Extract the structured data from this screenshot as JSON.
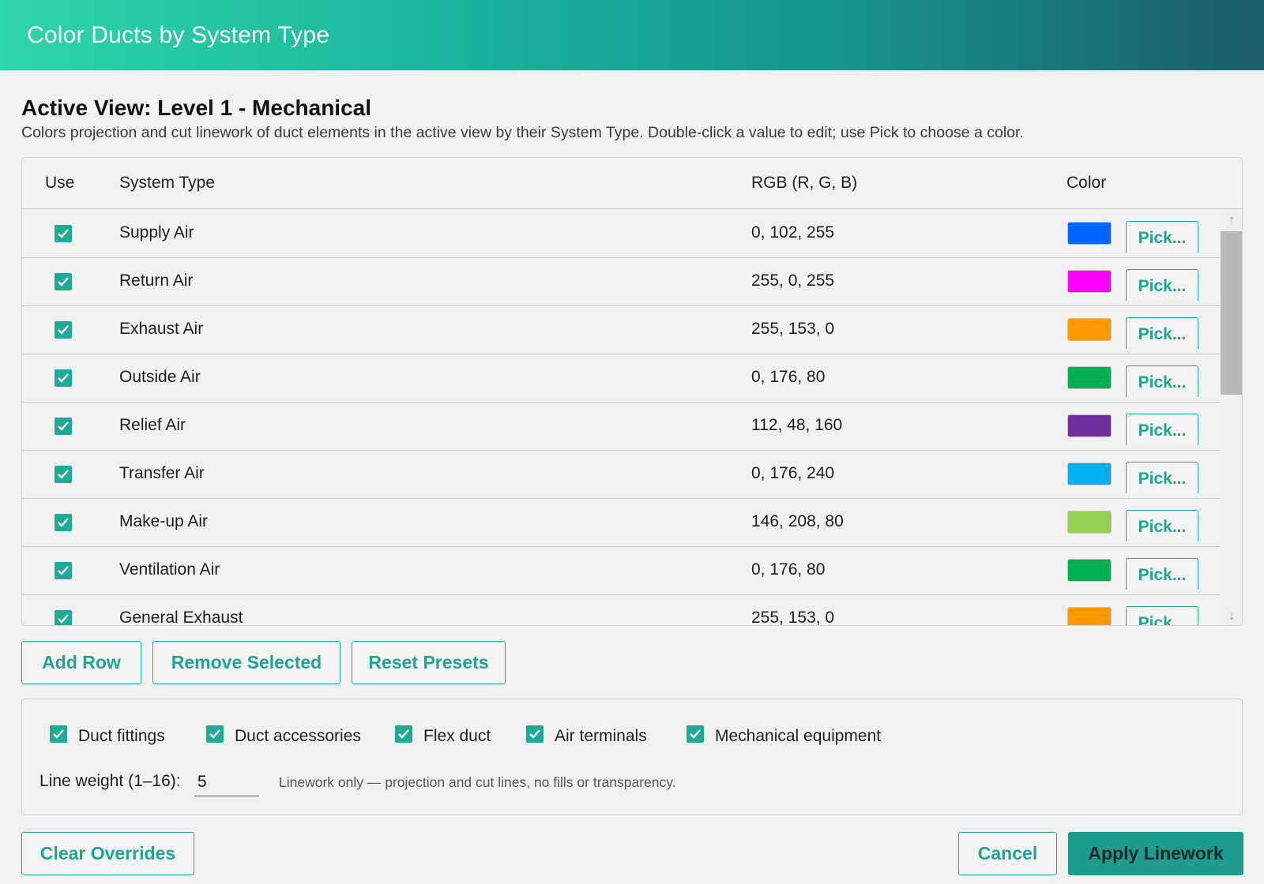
{
  "window": {
    "title": "Color Ducts by System Type"
  },
  "view": {
    "heading": "Active View: Level 1 - Mechanical",
    "description": "Colors projection and cut linework of duct elements in the active view by their System Type. Double-click a value to edit; use Pick to choose a color."
  },
  "table": {
    "columns": {
      "use": "Use",
      "system_type": "System Type",
      "rgb": "RGB (R, G, B)",
      "color": "Color"
    },
    "pick_label": "Pick...",
    "rows": [
      {
        "checked": true,
        "system_type": "Supply Air",
        "rgb": "0, 102, 255",
        "color": "#0066ff"
      },
      {
        "checked": true,
        "system_type": "Return Air",
        "rgb": "255, 0, 255",
        "color": "#ff00ff"
      },
      {
        "checked": true,
        "system_type": "Exhaust Air",
        "rgb": "255, 153, 0",
        "color": "#ff9900"
      },
      {
        "checked": true,
        "system_type": "Outside Air",
        "rgb": "0, 176, 80",
        "color": "#00b050"
      },
      {
        "checked": true,
        "system_type": "Relief Air",
        "rgb": "112, 48, 160",
        "color": "#7030a0"
      },
      {
        "checked": true,
        "system_type": "Transfer Air",
        "rgb": "0, 176, 240",
        "color": "#00b0f0"
      },
      {
        "checked": true,
        "system_type": "Make-up Air",
        "rgb": "146, 208, 80",
        "color": "#92d050"
      },
      {
        "checked": true,
        "system_type": "Ventilation Air",
        "rgb": "0, 176, 80",
        "color": "#00b050"
      },
      {
        "checked": true,
        "system_type": "General Exhaust",
        "rgb": "255, 153, 0",
        "color": "#ff9900"
      }
    ],
    "scrollbar": {
      "up_icon": "↑",
      "down_icon": "↓"
    }
  },
  "table_actions": {
    "add_row": "Add Row",
    "remove_selected": "Remove Selected",
    "reset_presets": "Reset Presets"
  },
  "options": {
    "categories": [
      {
        "label": "Duct fittings",
        "checked": true
      },
      {
        "label": "Duct accessories",
        "checked": true
      },
      {
        "label": "Flex duct",
        "checked": true
      },
      {
        "label": "Air terminals",
        "checked": true
      },
      {
        "label": "Mechanical equipment",
        "checked": true
      }
    ],
    "line_weight_label": "Line weight (1–16):",
    "line_weight_value": "5",
    "note": "Linework only — projection and cut lines, no fills or transparency."
  },
  "footer": {
    "clear_overrides": "Clear Overrides",
    "cancel": "Cancel",
    "apply": "Apply Linework"
  },
  "theme": {
    "accent": "#1eab96",
    "apply_bg": "#1d9c8c"
  }
}
